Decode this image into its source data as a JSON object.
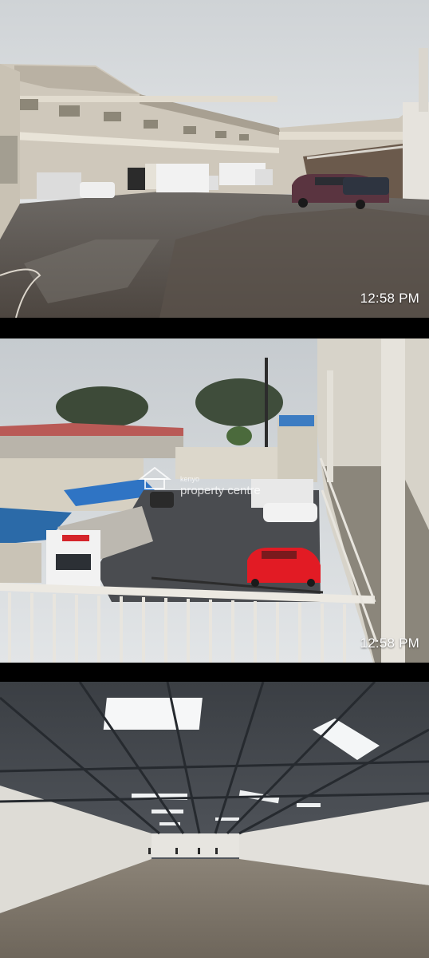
{
  "photos": [
    {
      "timestamp": "12:58 PM"
    },
    {
      "timestamp": "12:58 PM",
      "watermark_small": "kenyo",
      "watermark_main": "property centre"
    },
    {}
  ],
  "colors": {
    "background": "#000000",
    "roof_blue": "#2f74c4",
    "red_car": "#e21b24",
    "timestamp_text": "#ffffff"
  },
  "icons": [
    "house-watermark-icon"
  ]
}
